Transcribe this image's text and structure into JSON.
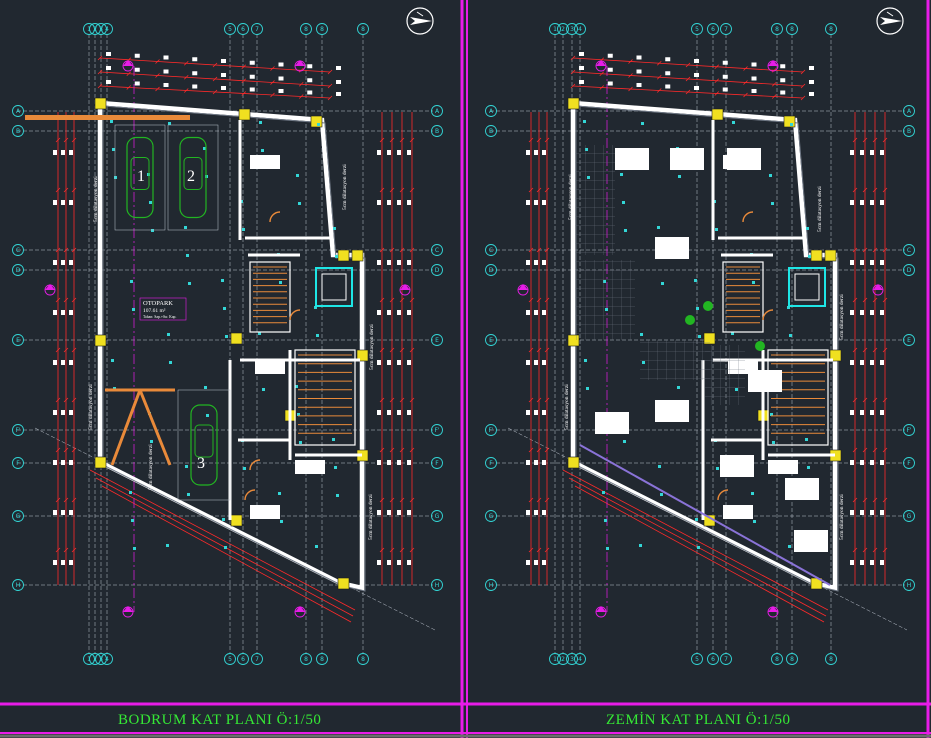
{
  "plans": [
    {
      "title": "BODRUM  KAT  PLANI Ö:1/50",
      "parking": {
        "label": "OTOPARK",
        "area": "107.61 m²",
        "finish": "Taban: Sap.+Sır. Kap."
      },
      "car_numbers": [
        "1",
        "2",
        "3"
      ],
      "dilatation_label": "5cm dilatasyon derzi"
    },
    {
      "title": "ZEMİN  KAT  PLANI Ö:1/50",
      "dilatation_label": "5cm dilatasyon derzi"
    }
  ],
  "grid_rows": [
    "A",
    "B",
    "C",
    "D",
    "E",
    "F",
    "G",
    "H"
  ],
  "extra_grid_row": "F'",
  "grid_cols_left": [
    "1",
    "2",
    "3",
    "4",
    "5",
    "6",
    "7",
    "8"
  ],
  "grid_cols_right": [
    "1",
    "2",
    "3",
    "4",
    "5",
    "6",
    "7",
    "8"
  ],
  "section_markers": [
    "A",
    "A",
    "B",
    "B",
    "C",
    "C"
  ],
  "colors": {
    "background": "#212830",
    "frame": "#e81ce8",
    "grid": "#bfc6d0",
    "label_circle": "#33d6d6",
    "wall": "#ffffff",
    "dimension": "#ff2a2a",
    "stair": "#e98a3a",
    "column": "#f0e020",
    "title": "#35e835",
    "car": "#22b522",
    "glass": "#1ee6e6"
  },
  "north_arrow_icons": [
    "north-arrow-icon",
    "north-arrow-icon"
  ]
}
